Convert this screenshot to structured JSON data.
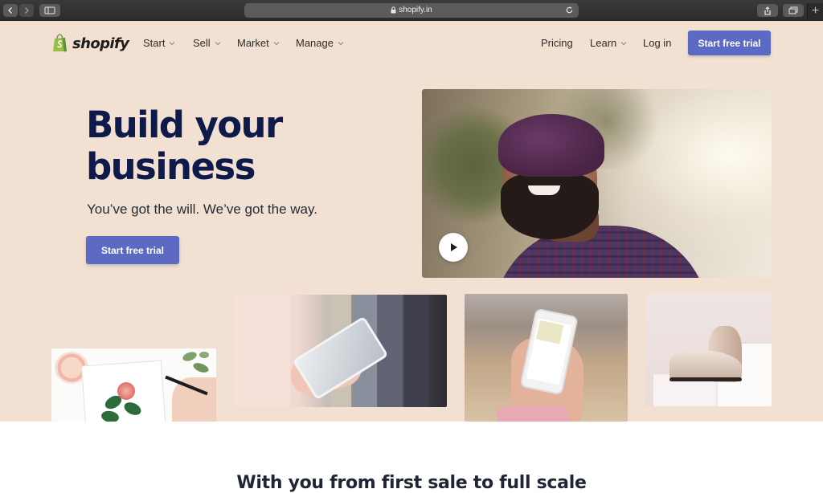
{
  "browser": {
    "url": "shopify.in"
  },
  "brand": {
    "name": "shopify",
    "accent": "#5c6ac4",
    "hero_bg": "#f2e1d3",
    "logo_green": "#95bf47"
  },
  "nav": {
    "items": [
      {
        "label": "Start",
        "dropdown": true
      },
      {
        "label": "Sell",
        "dropdown": true
      },
      {
        "label": "Market",
        "dropdown": true
      },
      {
        "label": "Manage",
        "dropdown": true
      }
    ],
    "right": {
      "pricing": "Pricing",
      "learn": "Learn",
      "login": "Log in",
      "cta": "Start free trial"
    }
  },
  "hero": {
    "title_line1": "Build your",
    "title_line2": "business",
    "subtitle": "You’ve got the will. We’ve got the way.",
    "cta": "Start free trial"
  },
  "section": {
    "heading": "With you from first sale to full scale"
  }
}
